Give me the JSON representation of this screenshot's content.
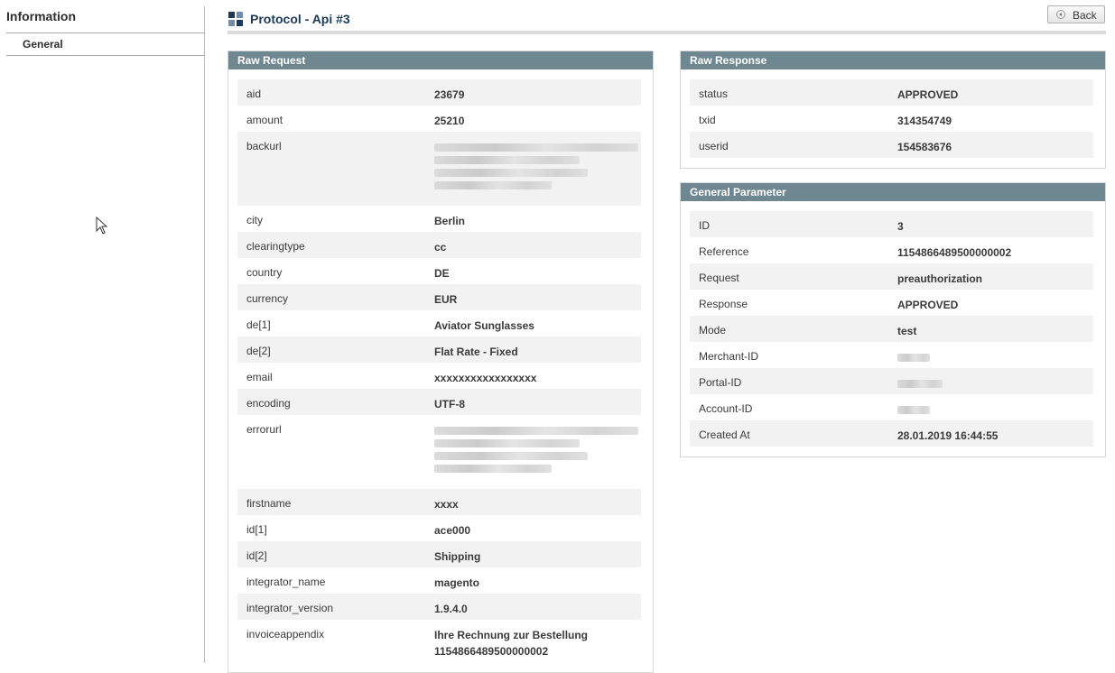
{
  "sidebar": {
    "title": "Information",
    "items": [
      {
        "label": "General"
      }
    ]
  },
  "header": {
    "title": "Protocol - Api #3",
    "back_label": "Back"
  },
  "raw_request": {
    "title": "Raw Request",
    "rows": [
      {
        "key": "aid",
        "value": "23679"
      },
      {
        "key": "amount",
        "value": "25210"
      },
      {
        "key": "backurl",
        "value": ""
      },
      {
        "key": "city",
        "value": "Berlin"
      },
      {
        "key": "clearingtype",
        "value": "cc"
      },
      {
        "key": "country",
        "value": "DE"
      },
      {
        "key": "currency",
        "value": "EUR"
      },
      {
        "key": "de[1]",
        "value": "Aviator Sunglasses"
      },
      {
        "key": "de[2]",
        "value": "Flat Rate - Fixed"
      },
      {
        "key": "email",
        "value": "xxxxxxxxxxxxxxxxx"
      },
      {
        "key": "encoding",
        "value": "UTF-8"
      },
      {
        "key": "errorurl",
        "value": ""
      },
      {
        "key": "firstname",
        "value": "xxxx"
      },
      {
        "key": "id[1]",
        "value": "ace000"
      },
      {
        "key": "id[2]",
        "value": "Shipping"
      },
      {
        "key": "integrator_name",
        "value": "magento"
      },
      {
        "key": "integrator_version",
        "value": "1.9.4.0"
      },
      {
        "key": "invoiceappendix",
        "value": "Ihre Rechnung zur Bestellung 1154866489500000002"
      }
    ]
  },
  "raw_response": {
    "title": "Raw Response",
    "rows": [
      {
        "key": "status",
        "value": "APPROVED"
      },
      {
        "key": "txid",
        "value": "314354749"
      },
      {
        "key": "userid",
        "value": "154583676"
      }
    ]
  },
  "general_parameter": {
    "title": "General Parameter",
    "rows": [
      {
        "key": "ID",
        "value": "3"
      },
      {
        "key": "Reference",
        "value": "1154866489500000002"
      },
      {
        "key": "Request",
        "value": "preauthorization"
      },
      {
        "key": "Response",
        "value": "APPROVED"
      },
      {
        "key": "Mode",
        "value": "test"
      },
      {
        "key": "Merchant-ID",
        "value": ""
      },
      {
        "key": "Portal-ID",
        "value": ""
      },
      {
        "key": "Account-ID",
        "value": ""
      },
      {
        "key": "Created At",
        "value": "28.01.2019 16:44:55"
      }
    ]
  },
  "colors": {
    "panel_header": "#6f8790",
    "title_text": "#1c3a55",
    "alt_row": "#f2f2f2"
  },
  "icons": [
    "grid-icon",
    "back-arrow-icon",
    "mouse-cursor-icon"
  ]
}
